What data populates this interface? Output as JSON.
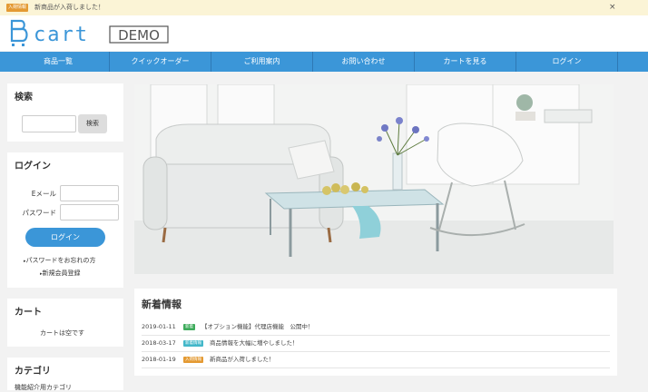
{
  "topbar": {
    "badge": "入荷情報",
    "badge_color": "#e49a33",
    "message": "新商品が入荷しました！",
    "close_icon": "×"
  },
  "brand": {
    "logo_text": "cart",
    "demo_label": "DEMO",
    "accent": "#3b96d8"
  },
  "nav": {
    "items": [
      {
        "label": "商品一覧"
      },
      {
        "label": "クイックオーダー"
      },
      {
        "label": "ご利用案内"
      },
      {
        "label": "お問い合わせ"
      },
      {
        "label": "カートを見る"
      },
      {
        "label": "ログイン"
      }
    ]
  },
  "search": {
    "heading": "検索",
    "button": "検索",
    "value": ""
  },
  "login": {
    "heading": "ログイン",
    "email_label": "Eメール",
    "password_label": "パスワード",
    "email_value": "",
    "password_value": "",
    "button": "ログイン",
    "forgot_link": "パスワードをお忘れの方",
    "register_link": "新規会員登録"
  },
  "cart": {
    "heading": "カート",
    "empty_text": "カートは空です"
  },
  "category": {
    "heading": "カテゴリ",
    "first_item": "機能紹介用カテゴリ"
  },
  "news": {
    "heading": "新着情報",
    "items": [
      {
        "date": "2019-01-11",
        "tag": "新着",
        "tag_color": "#3eab5b",
        "title": "【オプション機能】代理店機能　公開中！"
      },
      {
        "date": "2018-03-17",
        "tag": "新着情報",
        "tag_color": "#43b7c9",
        "title": "商品情報を大幅に増やしました！"
      },
      {
        "date": "2018-01-19",
        "tag": "入荷情報",
        "tag_color": "#e49a33",
        "title": "新商品が入荷しました！"
      }
    ]
  }
}
